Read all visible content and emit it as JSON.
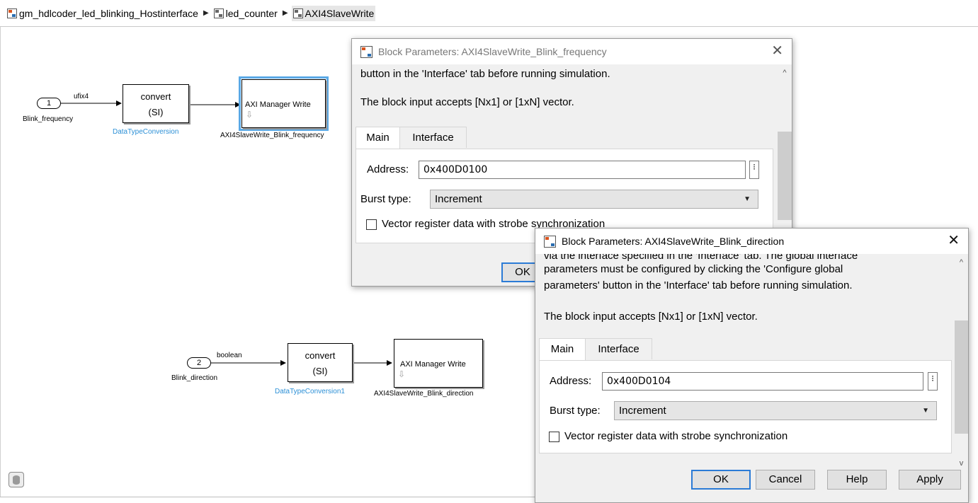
{
  "breadcrumb": {
    "items": [
      {
        "label": "gm_hdlcoder_led_blinking_Hostinterface"
      },
      {
        "label": "led_counter"
      },
      {
        "label": "AXI4SlaveWrite"
      }
    ]
  },
  "diagram": {
    "row1": {
      "inport_number": "1",
      "inport_name": "Blink_frequency",
      "signal_type": "ufix4",
      "convert_line1": "convert",
      "convert_line2": "(SI)",
      "convert_name": "DataTypeConversion",
      "axi_text": "AXI Manager Write",
      "axi_name": "AXI4SlaveWrite_Blink_frequency"
    },
    "row2": {
      "inport_number": "2",
      "inport_name": "Blink_direction",
      "signal_type": "boolean",
      "convert_line1": "convert",
      "convert_line2": "(SI)",
      "convert_name": "DataTypeConversion1",
      "axi_text": "AXI Manager Write",
      "axi_name": "AXI4SlaveWrite_Blink_direction"
    }
  },
  "dialog1": {
    "title": "Block Parameters: AXI4SlaveWrite_Blink_frequency",
    "desc_lines": [
      "button in the 'Interface' tab before running simulation.",
      "The block input accepts  [Nx1] or [1xN] vector."
    ],
    "tabs": [
      "Main",
      "Interface"
    ],
    "address_label": "Address:",
    "address_value": "0x400D0100",
    "burst_label": "Burst type:",
    "burst_value": "Increment",
    "checkbox_label": "Vector register data with strobe synchronization",
    "ok_label": "OK"
  },
  "dialog2": {
    "title": "Block Parameters: AXI4SlaveWrite_Blink_direction",
    "desc_lines": [
      "via the interface specified in the 'Interface' tab. The global interface",
      "parameters must be configured by clicking the 'Configure global",
      "parameters' button in the 'Interface' tab before running simulation.",
      "The block input accepts  [Nx1] or [1xN] vector."
    ],
    "tabs": [
      "Main",
      "Interface"
    ],
    "address_label": "Address:",
    "address_value": "0x400D0104",
    "burst_label": "Burst type:",
    "burst_value": "Increment",
    "checkbox_label": "Vector register data with strobe synchronization",
    "buttons": {
      "ok": "OK",
      "cancel": "Cancel",
      "help": "Help",
      "apply": "Apply"
    }
  },
  "icons": {
    "model": "simulink-model-icon",
    "subsystem": "subsystem-icon",
    "breadcrumb_separator": "triangle-right-icon",
    "close": "close-icon",
    "dropdown": "caret-down-icon",
    "database": "database-icon"
  },
  "colors": {
    "selection": "#5aa9e6",
    "block_name_blue": "#2b8fd6",
    "default_button_border": "#2b7bd6"
  }
}
